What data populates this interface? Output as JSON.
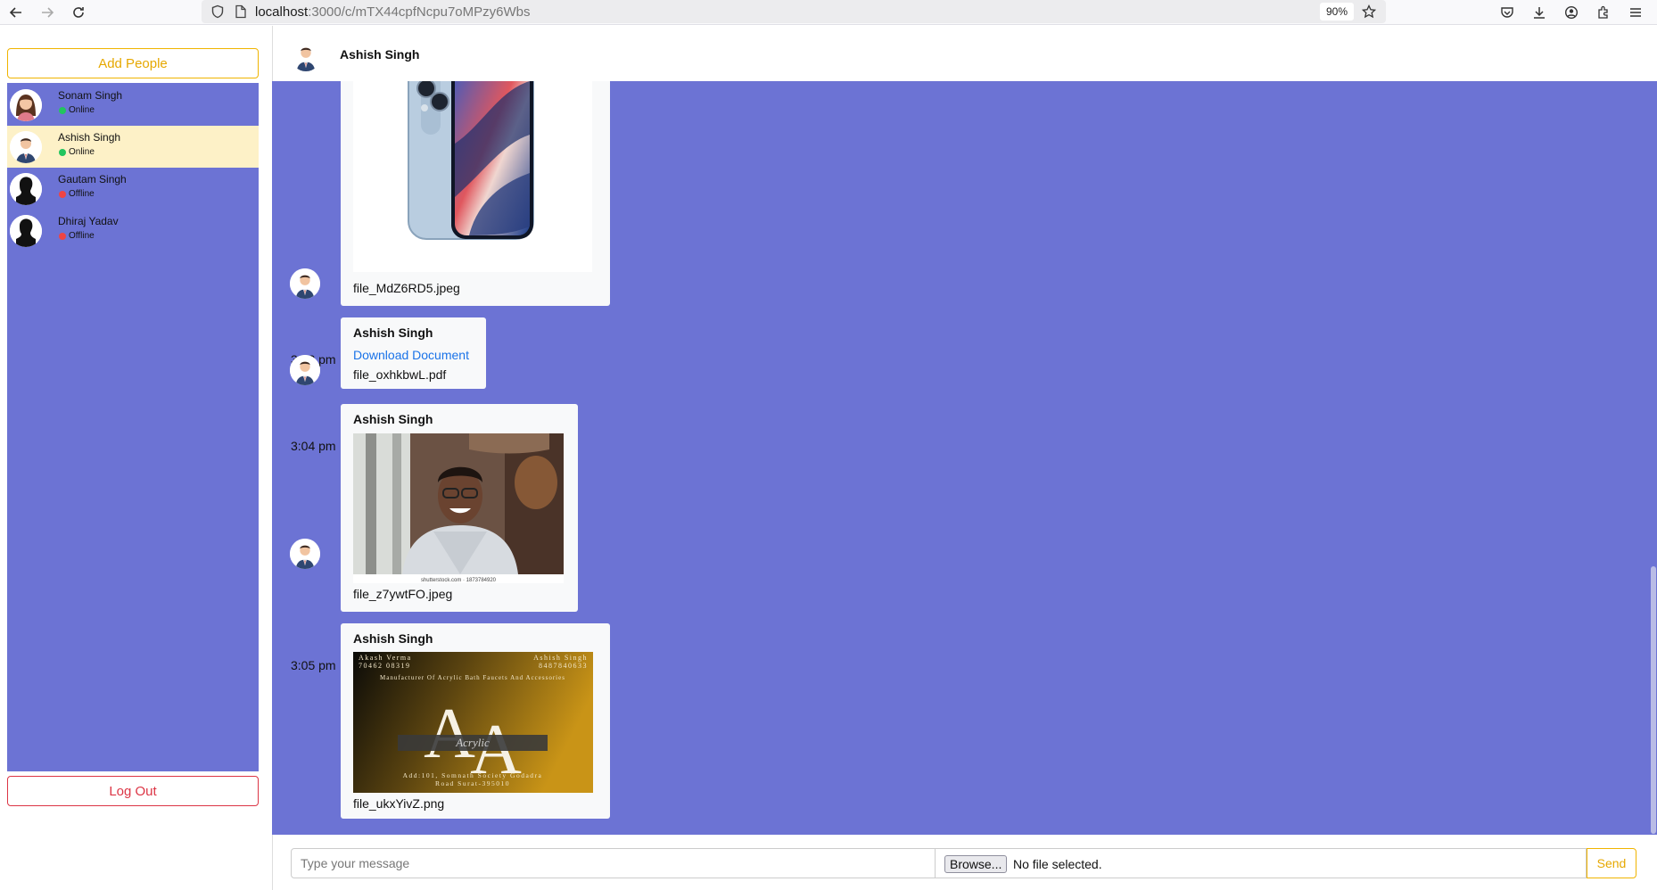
{
  "browser": {
    "url_host": "localhost",
    "url_path": ":3000/c/mTX44cpfNcpu7oMPzy6Wbs",
    "zoom": "90%",
    "icons": [
      "back-icon",
      "forward-icon",
      "reload-icon",
      "shield-icon",
      "page-icon",
      "star-icon",
      "pocket-icon",
      "download-icon",
      "account-icon",
      "extensions-icon",
      "menu-icon"
    ]
  },
  "sidebar": {
    "add_label": "Add People",
    "logout_label": "Log Out",
    "users": [
      {
        "name": "Sonam Singh",
        "status": "Online",
        "status_color": "#22c55e",
        "avatar": "female-avatar",
        "active": false
      },
      {
        "name": "Ashish Singh",
        "status": "Online",
        "status_color": "#22c55e",
        "avatar": "male-suit-avatar",
        "active": true
      },
      {
        "name": "Gautam Singh",
        "status": "Offline",
        "status_color": "#ef4444",
        "avatar": "silhouette-avatar",
        "active": false
      },
      {
        "name": "Dhiraj Yadav",
        "status": "Offline",
        "status_color": "#ef4444",
        "avatar": "silhouette-avatar",
        "active": false
      }
    ]
  },
  "chat": {
    "header_name": "Ashish Singh",
    "messages": [
      {
        "sender": "",
        "time": "",
        "type": "image",
        "file": "file_MdZ6RD5.jpeg",
        "image": "phone-photo"
      },
      {
        "sender": "Ashish Singh",
        "time": "3:02 pm",
        "type": "document",
        "link_label": "Download Document",
        "file": "file_oxhkbwL.pdf"
      },
      {
        "sender": "Ashish Singh",
        "time": "3:04 pm",
        "type": "image",
        "file": "file_z7ywtFO.jpeg",
        "image": "portrait-photo",
        "watermark": "shutterstock.com · 1873784920"
      },
      {
        "sender": "Ashish Singh",
        "time": "3:05 pm",
        "type": "image",
        "file": "file_ukxYivZ.png",
        "image": "business-card",
        "card": {
          "left_name": "Akash Verma",
          "left_phone": "70462 08319",
          "right_name": "Ashish Singh",
          "right_phone": "8487840633",
          "tagline": "Manufacturer Of Acrylic Bath Faucets And Accessories",
          "brand": "Acrylic",
          "address_line1": "Add:101, Somnath Society Godadra",
          "address_line2": "Road Surat-395010"
        }
      }
    ]
  },
  "composer": {
    "placeholder": "Type your message",
    "browse_label": "Browse...",
    "no_file_label": "No file selected.",
    "send_label": "Send"
  },
  "colors": {
    "accent": "#6c73d4",
    "active_user": "#fdf1c7",
    "warning": "#f0b400",
    "danger": "#dc3545",
    "link": "#1a73e8"
  }
}
